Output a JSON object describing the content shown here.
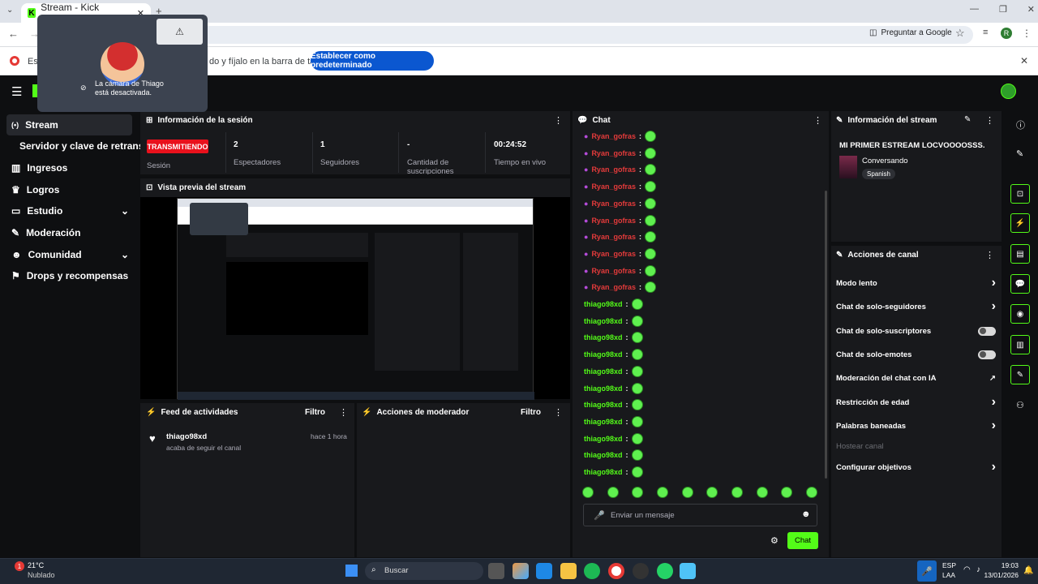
{
  "browser": {
    "tab_title": "Stream - Kick Dashboard",
    "google_label": "Preguntar a Google",
    "profile_initial": "R"
  },
  "infobar": {
    "text_prefix": "Est",
    "text_suffix": "do y fíjalo en la barra de tareas",
    "button": "Establecer como predeterminado"
  },
  "camera_popup": {
    "text": "La cámara de Thiago está desactivada."
  },
  "sidebar": {
    "items": [
      {
        "label": "Stream",
        "icon": "stream-icon"
      },
      {
        "label": "Servidor y clave de retransm"
      },
      {
        "label": "Ingresos",
        "icon": "chart-icon"
      },
      {
        "label": "Logros",
        "icon": "trophy-icon"
      },
      {
        "label": "Estudio",
        "icon": "studio-icon"
      },
      {
        "label": "Moderación",
        "icon": "wrench-icon"
      },
      {
        "label": "Comunidad",
        "icon": "people-icon"
      },
      {
        "label": "Drops y recompensas",
        "icon": "gift-icon"
      }
    ]
  },
  "session": {
    "title": "Información de la sesión",
    "status": "TRANSMITIENDO",
    "status_label": "Sesión",
    "stats": [
      {
        "value": "2",
        "label": "Espectadores"
      },
      {
        "value": "1",
        "label": "Seguidores"
      },
      {
        "value": "-",
        "label": "Cantidad de suscripciones"
      },
      {
        "value": "00:24:52",
        "label": "Tiempo en vivo"
      }
    ]
  },
  "preview": {
    "title": "Vista previa del stream"
  },
  "feed": {
    "title": "Feed de actividades",
    "filter": "Filtro",
    "user": "thiago98xd",
    "time": "hace 1 hora",
    "action": "acaba de seguir el canal"
  },
  "mod_actions": {
    "title": "Acciones de moderador",
    "filter": "Filtro"
  },
  "chat": {
    "title": "Chat",
    "messages": [
      {
        "user": "Ryan_gofras",
        "color": "#e63b3b"
      },
      {
        "user": "Ryan_gofras",
        "color": "#e63b3b"
      },
      {
        "user": "Ryan_gofras",
        "color": "#e63b3b"
      },
      {
        "user": "Ryan_gofras",
        "color": "#e63b3b"
      },
      {
        "user": "Ryan_gofras",
        "color": "#e63b3b"
      },
      {
        "user": "Ryan_gofras",
        "color": "#e63b3b"
      },
      {
        "user": "Ryan_gofras",
        "color": "#e63b3b"
      },
      {
        "user": "Ryan_gofras",
        "color": "#e63b3b"
      },
      {
        "user": "Ryan_gofras",
        "color": "#e63b3b"
      },
      {
        "user": "Ryan_gofras",
        "color": "#e63b3b"
      },
      {
        "user": "thiago98xd",
        "color": "#53fc18"
      },
      {
        "user": "thiago98xd",
        "color": "#53fc18"
      },
      {
        "user": "thiago98xd",
        "color": "#53fc18"
      },
      {
        "user": "thiago98xd",
        "color": "#53fc18"
      },
      {
        "user": "thiago98xd",
        "color": "#53fc18"
      },
      {
        "user": "thiago98xd",
        "color": "#53fc18"
      },
      {
        "user": "thiago98xd",
        "color": "#53fc18"
      },
      {
        "user": "thiago98xd",
        "color": "#53fc18"
      },
      {
        "user": "thiago98xd",
        "color": "#53fc18"
      },
      {
        "user": "thiago98xd",
        "color": "#53fc18"
      },
      {
        "user": "thiago98xd",
        "color": "#53fc18"
      }
    ],
    "input_placeholder": "Enviar un mensaje",
    "send": "Chat"
  },
  "stream_info": {
    "title": "Información del stream",
    "stream_title": "MI PRIMER ESTREAM LOCVOOOOSSS.",
    "category": "Conversando",
    "language": "Spanish"
  },
  "channel_actions": {
    "title": "Acciones de canal",
    "items": [
      {
        "label": "Modo lento",
        "type": "arrow"
      },
      {
        "label": "Chat de solo-seguidores",
        "type": "arrow"
      },
      {
        "label": "Chat de solo-suscriptores",
        "type": "toggle"
      },
      {
        "label": "Chat de solo-emotes",
        "type": "toggle"
      },
      {
        "label": "Moderación del chat con IA",
        "type": "external"
      },
      {
        "label": "Restricción de edad",
        "type": "arrow"
      },
      {
        "label": "Palabras baneadas",
        "type": "arrow"
      },
      {
        "label": "Hostear canal",
        "type": "disabled"
      },
      {
        "label": "Configurar objetivos",
        "type": "arrow"
      }
    ]
  },
  "taskbar": {
    "weather_temp": "21°C",
    "weather_desc": "Nublado",
    "search": "Buscar",
    "lang": "ESP",
    "region": "LAA",
    "time": "19:03",
    "date": "13/01/2026"
  },
  "colors": {
    "kick_green": "#53fc18",
    "live_red": "#e9111c",
    "panel": "#18191c"
  }
}
